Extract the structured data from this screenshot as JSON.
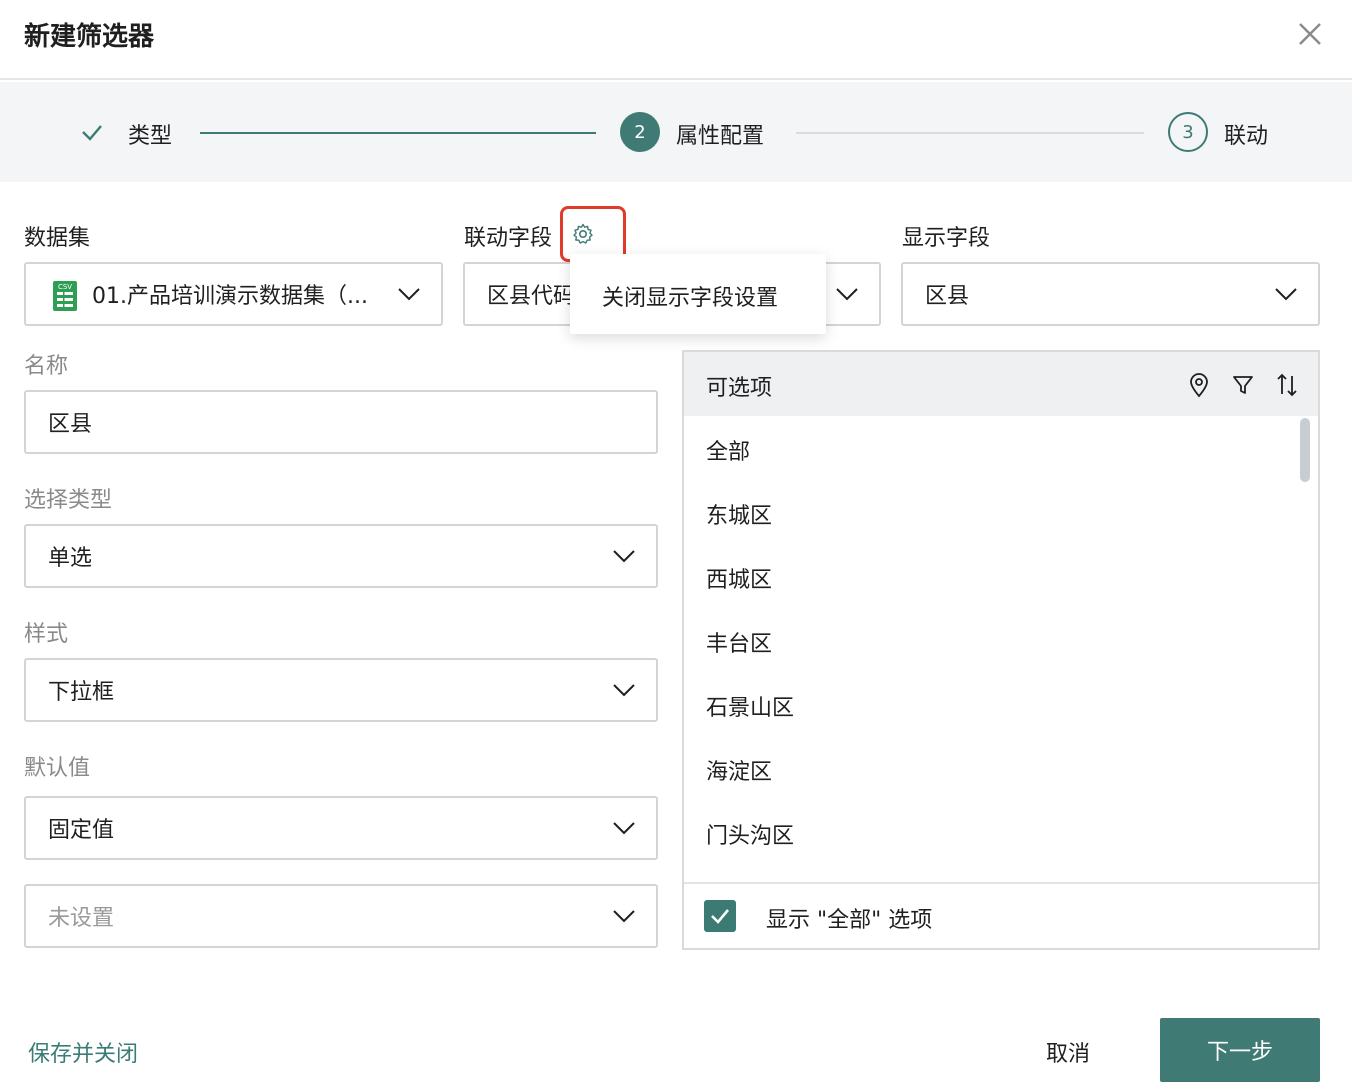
{
  "dialog": {
    "title": "新建筛选器"
  },
  "steps": [
    {
      "label": "类型",
      "state": "done"
    },
    {
      "label": "属性配置",
      "number": "2",
      "state": "active"
    },
    {
      "label": "联动",
      "number": "3",
      "state": "pending"
    }
  ],
  "fields": {
    "dataset": {
      "label": "数据集",
      "value": "01.产品培训演示数据集（...",
      "icon": "csv-file-icon"
    },
    "link_field": {
      "label": "联动字段",
      "value": "区县代码"
    },
    "display_field": {
      "label": "显示字段",
      "value": "区县"
    },
    "name": {
      "label": "名称",
      "value": "区县"
    },
    "select_type": {
      "label": "选择类型",
      "value": "单选"
    },
    "style": {
      "label": "样式",
      "value": "下拉框"
    },
    "default_value": {
      "label": "默认值",
      "value": "固定值"
    },
    "default_setting": {
      "placeholder": "未设置"
    }
  },
  "popup": {
    "text": "关闭显示字段设置"
  },
  "options_panel": {
    "title": "可选项",
    "items": [
      "全部",
      "东城区",
      "西城区",
      "丰台区",
      "石景山区",
      "海淀区",
      "门头沟区"
    ],
    "show_all_label": "显示 \"全部\" 选项",
    "show_all_checked": true
  },
  "footer": {
    "save_close": "保存并关闭",
    "cancel": "取消",
    "next": "下一步"
  },
  "colors": {
    "accent": "#3f7b74",
    "highlight": "#e03a2a"
  }
}
